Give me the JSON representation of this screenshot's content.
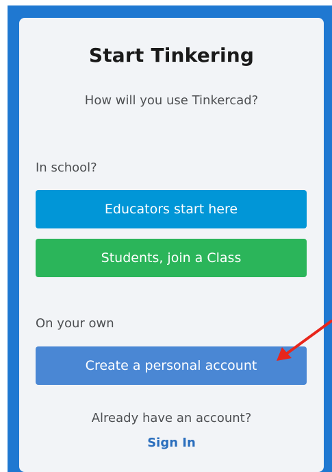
{
  "card": {
    "title": "Start Tinkering",
    "subtitle": "How will you use Tinkercad?"
  },
  "school_section": {
    "label": "In school?",
    "educators_button": "Educators start here",
    "students_button": "Students, join a Class"
  },
  "own_section": {
    "label": "On your own",
    "personal_button": "Create a personal account"
  },
  "signin_section": {
    "prompt": "Already have an account?",
    "signin_link": "Sign In"
  },
  "colors": {
    "frame_blue": "#1f78d1",
    "educators_blue": "#0196d7",
    "students_green": "#2bb55a",
    "personal_blue": "#4a87d4",
    "signin_link_blue": "#2a6ebd",
    "annotation_red": "#e8261c"
  }
}
